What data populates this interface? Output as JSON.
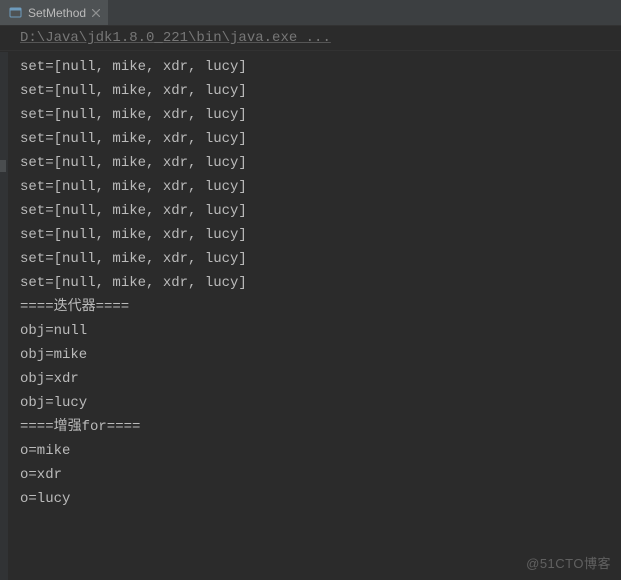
{
  "tab": {
    "label": "SetMethod",
    "icon": "run-icon"
  },
  "command": "D:\\Java\\jdk1.8.0_221\\bin\\java.exe ...",
  "console_lines": [
    "set=[null, mike, xdr, lucy]",
    "set=[null, mike, xdr, lucy]",
    "set=[null, mike, xdr, lucy]",
    "set=[null, mike, xdr, lucy]",
    "set=[null, mike, xdr, lucy]",
    "set=[null, mike, xdr, lucy]",
    "set=[null, mike, xdr, lucy]",
    "set=[null, mike, xdr, lucy]",
    "set=[null, mike, xdr, lucy]",
    "set=[null, mike, xdr, lucy]",
    "====迭代器====",
    "obj=null",
    "obj=mike",
    "obj=xdr",
    "obj=lucy",
    "====增强for====",
    "o=mike",
    "o=xdr",
    "o=lucy"
  ],
  "watermark": "@51CTO博客"
}
